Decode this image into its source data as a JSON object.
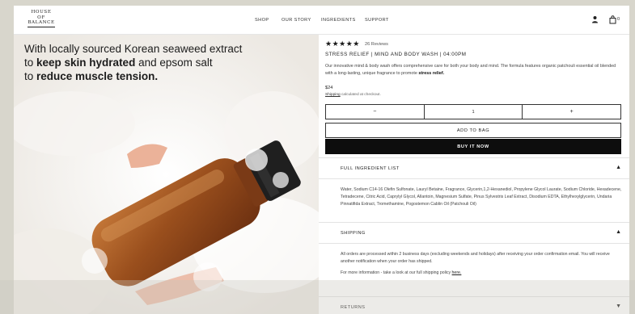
{
  "header": {
    "logo_line1": "HOUSE",
    "logo_line2": "OF",
    "logo_line3": "BALANCE",
    "nav": [
      "SHOP",
      "OUR STORY",
      "INGREDIENTS",
      "SUPPORT"
    ],
    "cart_count": "0",
    "icons": [
      "user-icon",
      "cart-icon"
    ]
  },
  "hero": {
    "line1": "With locally sourced Korean seaweed extract",
    "line2_pre": "to ",
    "line2_bold": "keep skin hydrated",
    "line2_post": " and epsom salt",
    "line3_pre": "to ",
    "line3_bold": "reduce muscle tension."
  },
  "product": {
    "stars": "★★★★★",
    "rating": 5,
    "reviews": "26 Reviews",
    "title": "STRESS RELIEF | MIND AND BODY WASH | 04:00PM",
    "description": "Our innovative mind & body wash offers comprehensive care for both your body and mind. The formula features organic patchouli essential oil blended with a long-lasting, unique fragrance to promote",
    "description_bold": "stress relief.",
    "price": "$24",
    "shipping_link": "Shipping",
    "shipping_suffix": "calculated at checkout.",
    "qty_minus": "−",
    "qty_value": "1",
    "qty_plus": "+",
    "add_to_bag": "ADD TO BAG",
    "buy_now": "BUY IT NOW"
  },
  "accordion": {
    "ingredients_title": "FULL INGREDIENT LIST",
    "ingredients_arrow": "▲",
    "ingredients_text": "Water, Sodium C14-16 Olefin Sulfonate, Lauryl Betaine, Fragrance, Glycerin,1,2-Hexanediol, Propylene Glycol Laurate, Sodium Chloride, Hexadecene, Tetradecene, Citric Acid, Caprylyl Glycol, Allantoin, Magnesium Sulfate, Pinus Sylvestris Leaf Extract, Disodium EDTA, Ethylhexylglycerin, Undaria Pinnatifida Extract, Tromethamine, Pogostemon Cablin Oil (Patchouli Oil)",
    "shipping_title": "SHIPPING",
    "shipping_arrow": "▲",
    "shipping_text1": "All orders are processed within 2 business days (excluding weekends and holidays) after receiving your order confirmation email. You will receive another notification when your order has shipped.",
    "shipping_text2_pre": "For more information - take a look at our full shipping policy ",
    "shipping_text2_link": "here.",
    "returns_title": "RETURNS",
    "returns_arrow": "▼"
  }
}
